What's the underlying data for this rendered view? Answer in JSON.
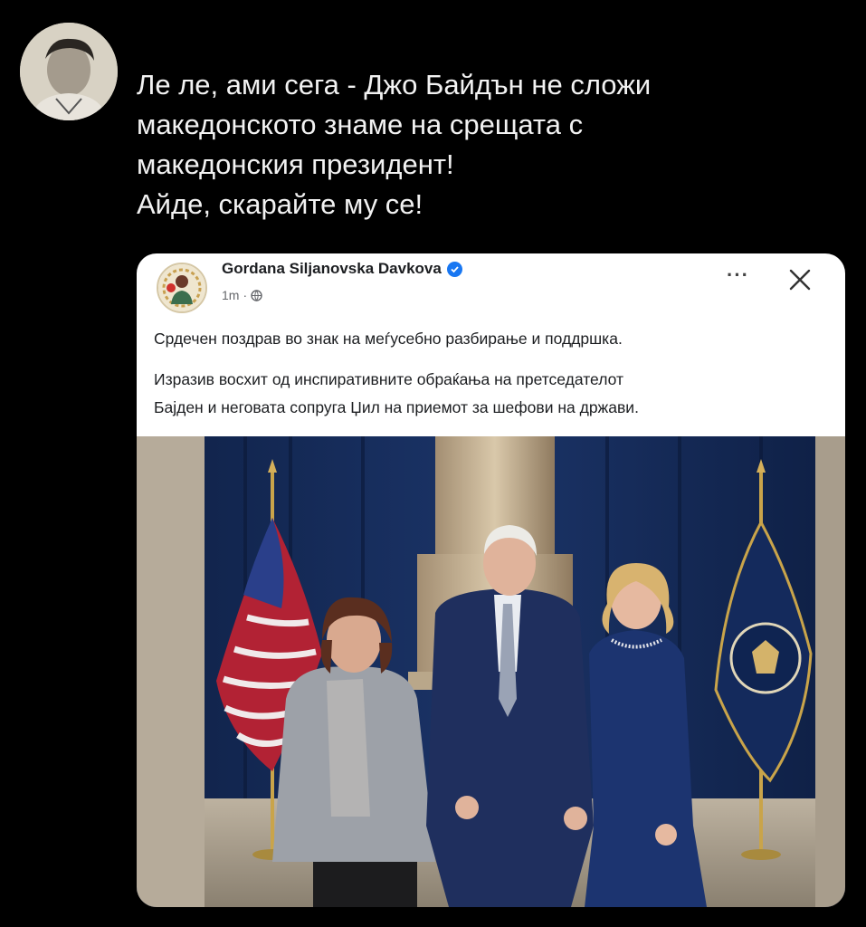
{
  "tweet": {
    "avatar_icon": "profile-photo",
    "text": "Ле ле, ами сега - Джо Байдън не сложи\nмакедонското знаме на срещата с\nмакедонския президент!\nАйде, скарайте му се!"
  },
  "fb_post": {
    "author": "Gordana Siljanovska Davkova",
    "time": "1m",
    "privacy_icon": "globe-icon",
    "verified_icon": "verified-badge-icon",
    "more_icon": "more-dots-icon",
    "close_icon": "close-icon",
    "more_label": "···",
    "paragraph1": "Срдечен поздрав во знак на меѓусебно разбирање и поддршка.",
    "paragraph2": "Изразив восхит од инспиративните обраќања на претседателот\nБајден и неговата сопруга Џил на приемот за шефови на држави.",
    "photo": "group-photo-four-flags"
  },
  "colors": {
    "background": "#000000",
    "card": "#ffffff",
    "verified": "#1877f2"
  }
}
